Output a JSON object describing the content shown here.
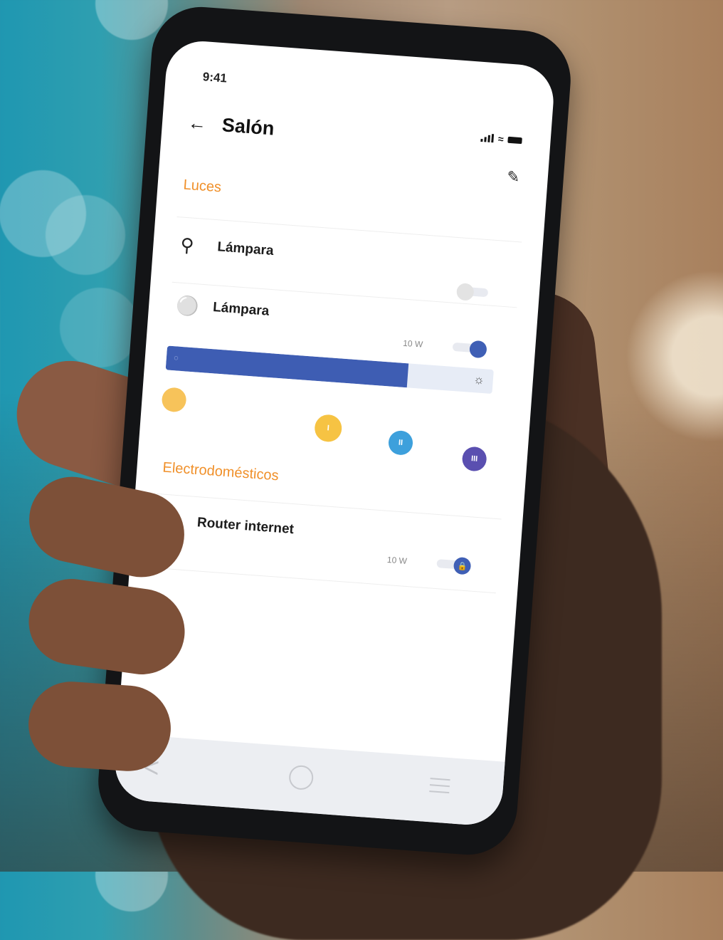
{
  "status_bar": {
    "time": "9:41"
  },
  "header": {
    "back_icon": "arrow-left-icon",
    "title": "Salón",
    "edit_icon": "pencil-icon"
  },
  "sections": [
    {
      "title": "Luces"
    },
    {
      "title": "Electrodomésticos"
    }
  ],
  "devices": [
    {
      "label": "Lámpara",
      "icon": "lamp-icon",
      "watt": "",
      "toggle": "off"
    },
    {
      "label": "Lámpara",
      "icon": "lightbulb-icon",
      "watt": "10 W",
      "toggle": "on",
      "brightness": 0.74
    },
    {
      "label": "Router internet",
      "icon": "router-icon",
      "watt": "10 W",
      "toggle": "locked"
    }
  ],
  "scenes": [
    {
      "name": "scene-sunset",
      "color": "#f7c35a"
    },
    {
      "name": "scene-i",
      "label": "I",
      "color": "#f6c343"
    },
    {
      "name": "scene-ii",
      "label": "II",
      "color": "#3da0dc"
    },
    {
      "name": "scene-iii",
      "label": "III",
      "color": "#5a4fb0"
    }
  ],
  "colors": {
    "accent": "#f0902a",
    "toggle_on": "#3f5fb5"
  }
}
